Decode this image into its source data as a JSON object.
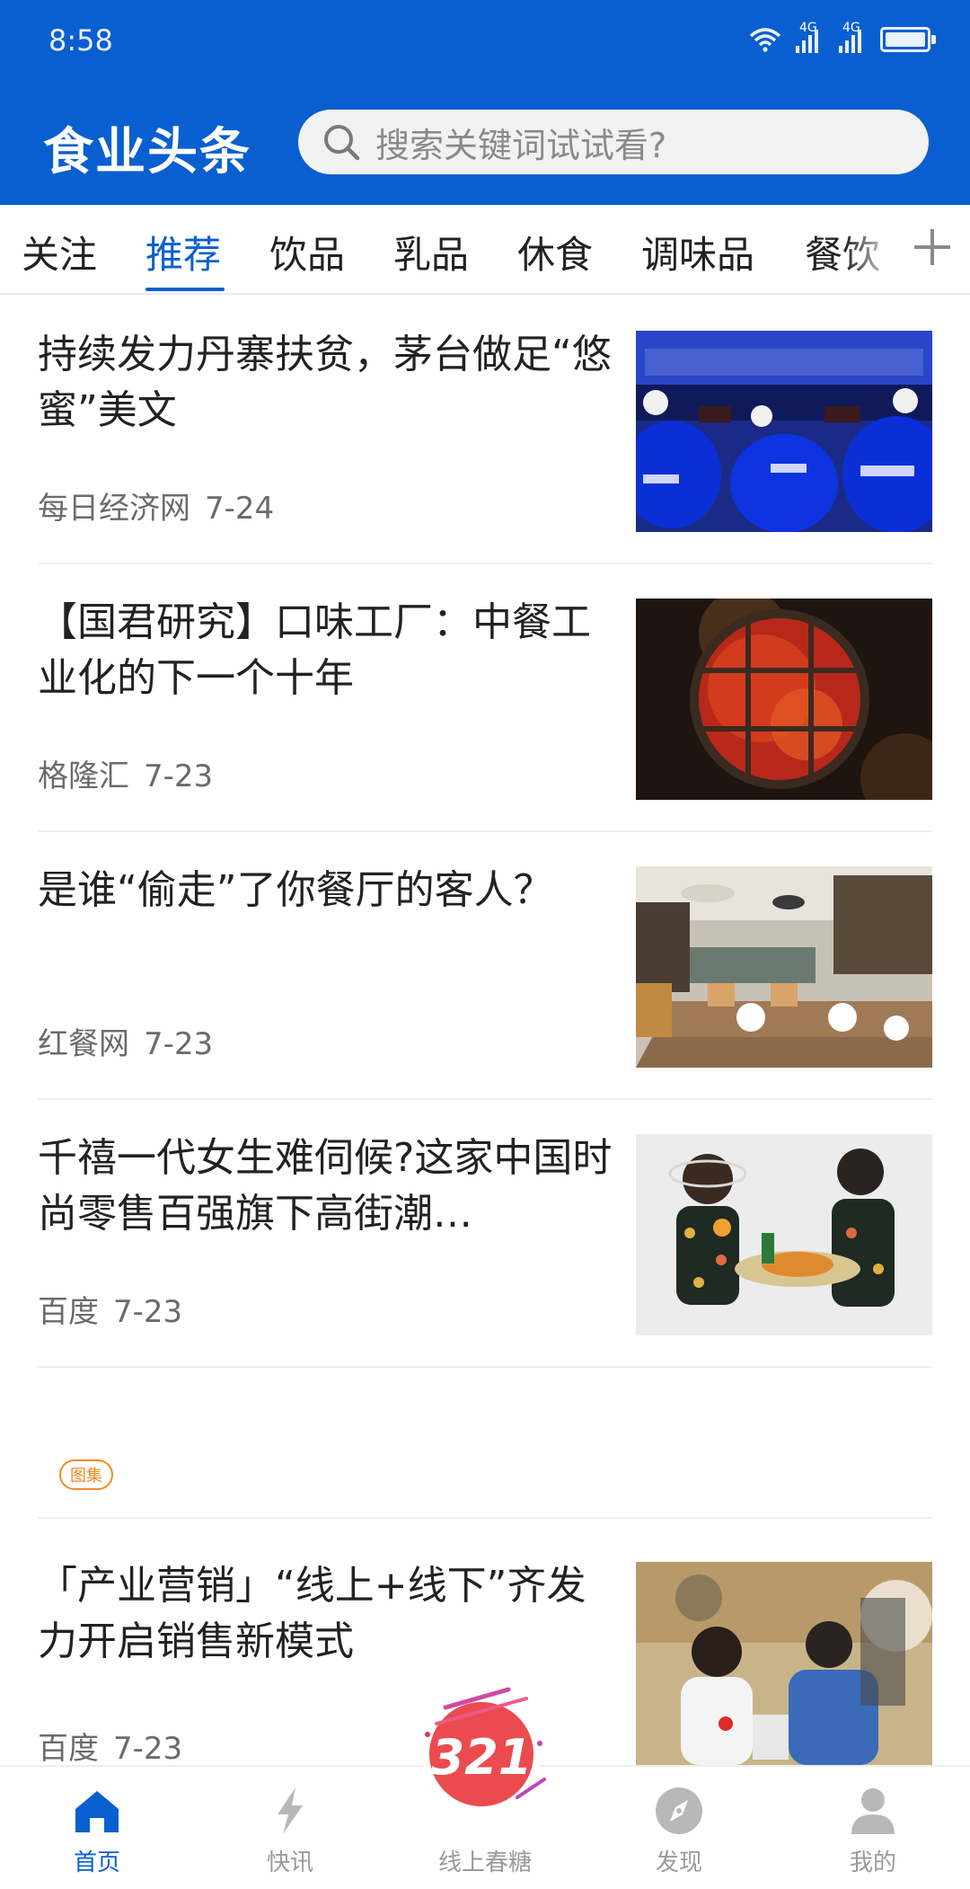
{
  "status": {
    "time": "8:58",
    "network_1": "4G",
    "network_2": "4G"
  },
  "header": {
    "logo": "食业头条",
    "search_placeholder": "搜索关键词试试看?"
  },
  "tabs": [
    {
      "label": "关注"
    },
    {
      "label": "推荐",
      "active": true
    },
    {
      "label": "饮品"
    },
    {
      "label": "乳品"
    },
    {
      "label": "休食"
    },
    {
      "label": "调味品"
    },
    {
      "label": "餐饮"
    }
  ],
  "articles": [
    {
      "title": "持续发力丹寨扶贫，茅台做足“悠蜜”美文",
      "source": "每日经济网",
      "date": "7-24",
      "image": "umeet-stage"
    },
    {
      "title": "【国君研究】口味工厂：中餐工业化的下一个十年",
      "source": "格隆汇",
      "date": "7-23",
      "image": "hotpot"
    },
    {
      "title": "是谁“偷走”了你餐厅的客人？",
      "source": "红餐网",
      "date": "7-23",
      "image": "restaurant-interior"
    },
    {
      "title": "千禧一代女生难伺候?这家中国时尚零售百强旗下高街潮…",
      "source": "百度",
      "date": "7-23",
      "image": "fashion-models"
    },
    {
      "title": "「产业营销」“线上+线下”齐发力开启销售新模式",
      "source": "百度",
      "date": "7-23",
      "image": "livestream"
    }
  ],
  "gallery_tag": "图集",
  "promo_badge": "321",
  "bottom_nav": [
    {
      "label": "首页",
      "icon": "home-icon",
      "active": true
    },
    {
      "label": "快讯",
      "icon": "lightning-icon"
    },
    {
      "label": "线上春糖",
      "icon": "promo-icon"
    },
    {
      "label": "发现",
      "icon": "compass-icon"
    },
    {
      "label": "我的",
      "icon": "user-icon"
    }
  ],
  "colors": {
    "brand": "#0a5fd0",
    "accent_tag": "#f08a24",
    "promo": "#e0325a"
  }
}
